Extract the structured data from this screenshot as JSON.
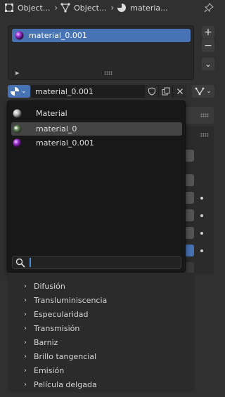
{
  "breadcrumb": [
    {
      "label": "Object...",
      "icon": "object-icon"
    },
    {
      "label": "Object...",
      "icon": "mesh-data-icon"
    },
    {
      "label": "materia...",
      "icon": "material-icon"
    }
  ],
  "slots": {
    "items": [
      {
        "label": "material_0.001",
        "selected": true
      }
    ]
  },
  "side_buttons": {
    "add": "+",
    "remove": "−",
    "menu": "⌄"
  },
  "datablock": {
    "name": "material_0.001"
  },
  "popup": {
    "items": [
      {
        "label": "Material",
        "icon": "material-preview-white-icon",
        "hover": false
      },
      {
        "label": "material_0",
        "icon": "material-preview-green-icon",
        "hover": true
      },
      {
        "label": "material_0.001",
        "icon": "material-preview-purple-icon",
        "hover": false
      }
    ],
    "search_value": ""
  },
  "sections": [
    "Difusión",
    "Transluminiscencia",
    "Especularidad",
    "Transmisión",
    "Barniz",
    "Brillo tangencial",
    "Emisión",
    "Película delgada"
  ],
  "colors": {
    "accent": "#4772b3",
    "background": "#303030",
    "popup": "#181818",
    "hover": "#444444"
  }
}
